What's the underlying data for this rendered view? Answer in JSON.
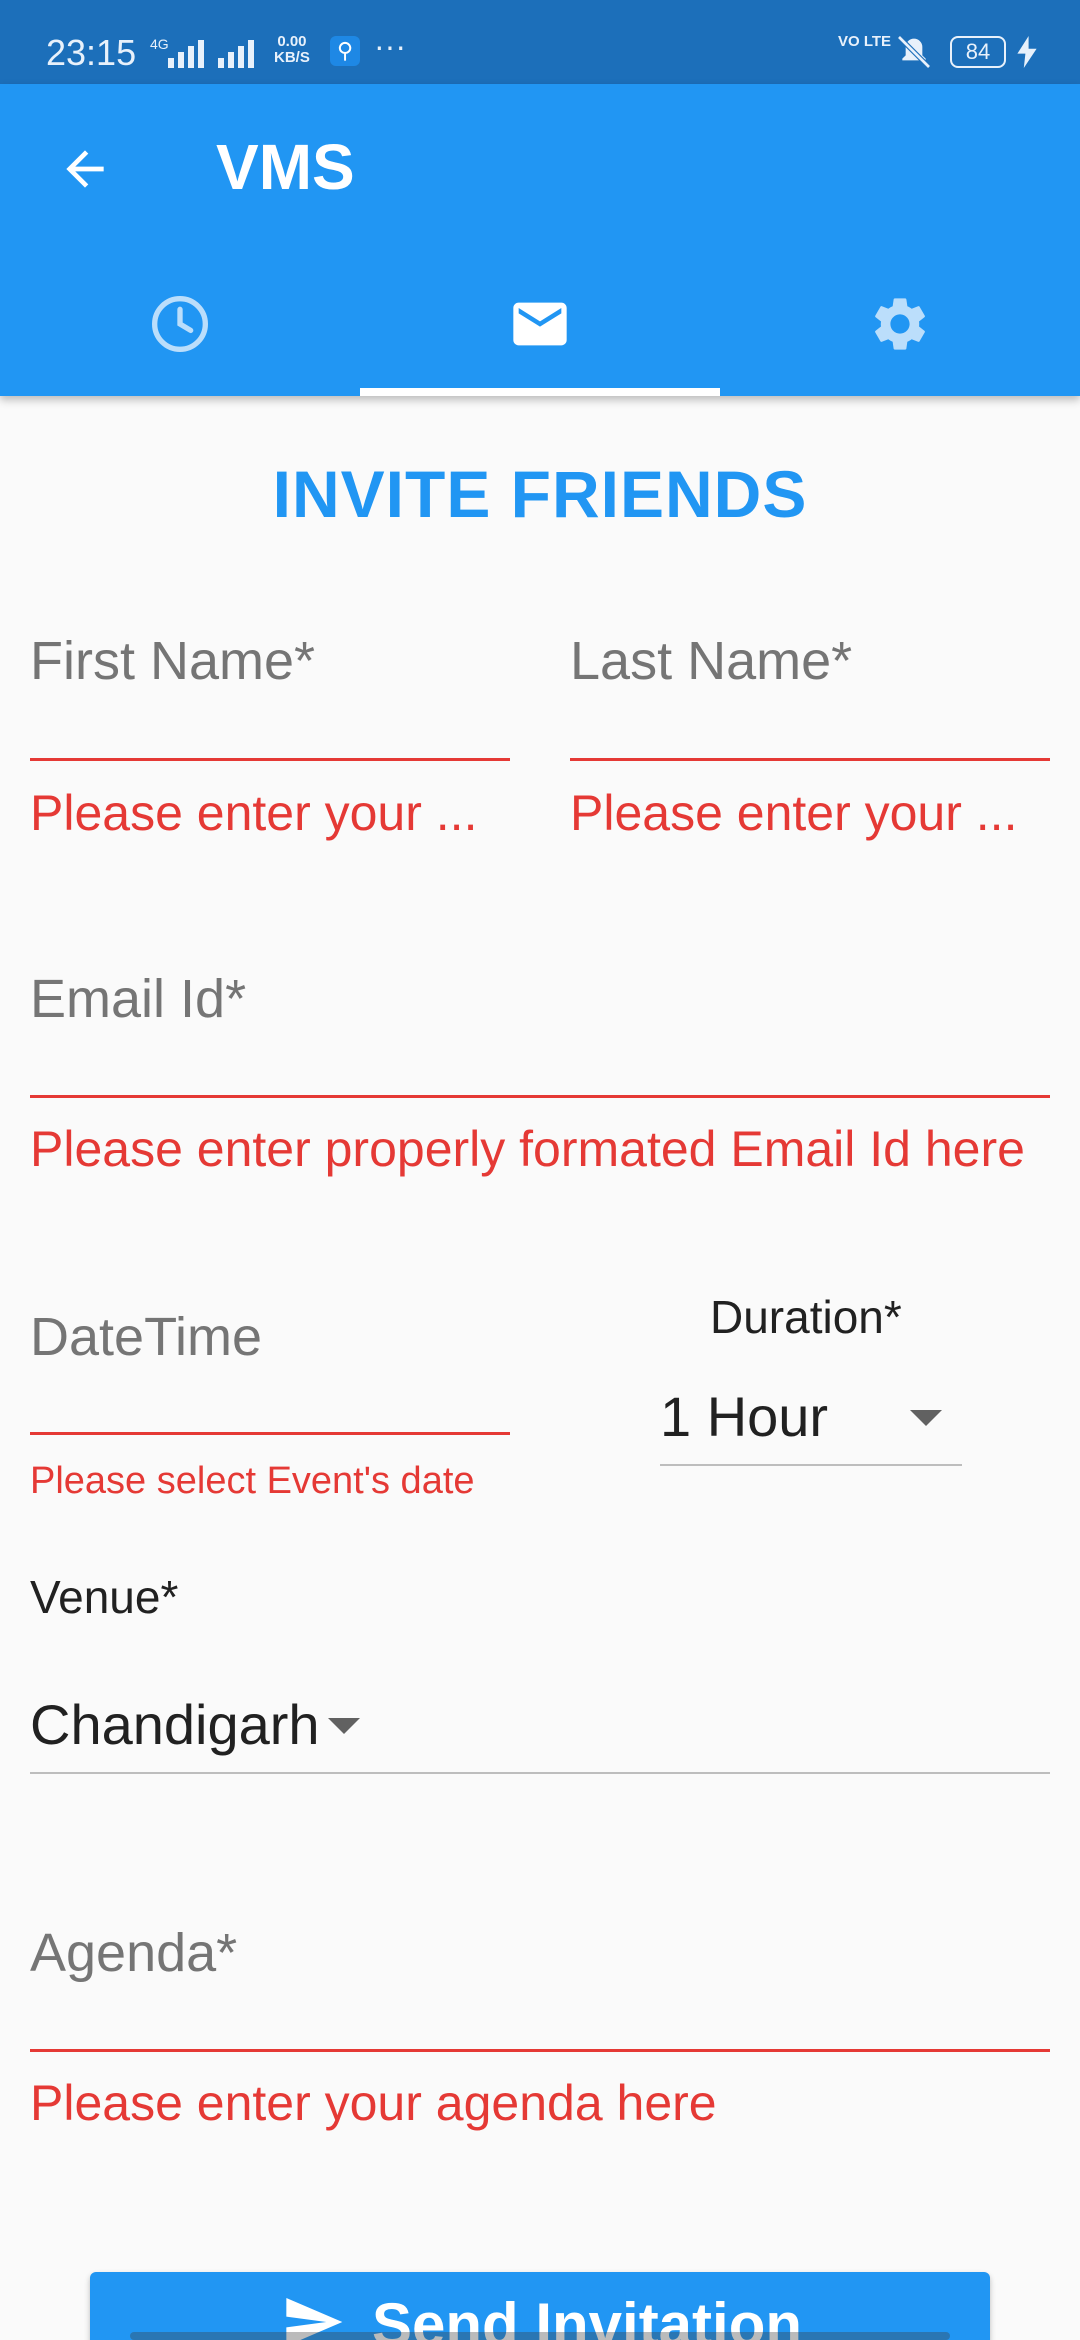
{
  "status_bar": {
    "time": "23:15",
    "network": "4G",
    "net_speed_value": "0.00",
    "net_speed_unit": "KB/S",
    "more": "···",
    "volte": "VO LTE",
    "battery": "84"
  },
  "app_bar": {
    "title": "VMS",
    "back_icon": "arrow-left-icon",
    "tabs": [
      {
        "icon": "clock-icon",
        "selected": false
      },
      {
        "icon": "mail-icon",
        "selected": true
      },
      {
        "icon": "gear-icon",
        "selected": false
      }
    ]
  },
  "form": {
    "heading": "INVITE FRIENDS",
    "first_name": {
      "label": "First Name*",
      "error": "Please enter your ..."
    },
    "last_name": {
      "label": "Last Name*",
      "error": "Please enter your ..."
    },
    "email": {
      "label": "Email Id*",
      "error": "Please enter properly formated Email Id here"
    },
    "datetime": {
      "label": "DateTime",
      "error": "Please select Event's date"
    },
    "duration": {
      "label": "Duration*",
      "value": "1 Hour"
    },
    "venue": {
      "label": "Venue*",
      "value": "Chandigarh"
    },
    "agenda": {
      "label": "Agenda*",
      "error": "Please enter your agenda here"
    },
    "send_button": "Send Invitation"
  },
  "colors": {
    "primary": "#2196f3",
    "status_bar": "#1c6fba",
    "error": "#e53935"
  }
}
